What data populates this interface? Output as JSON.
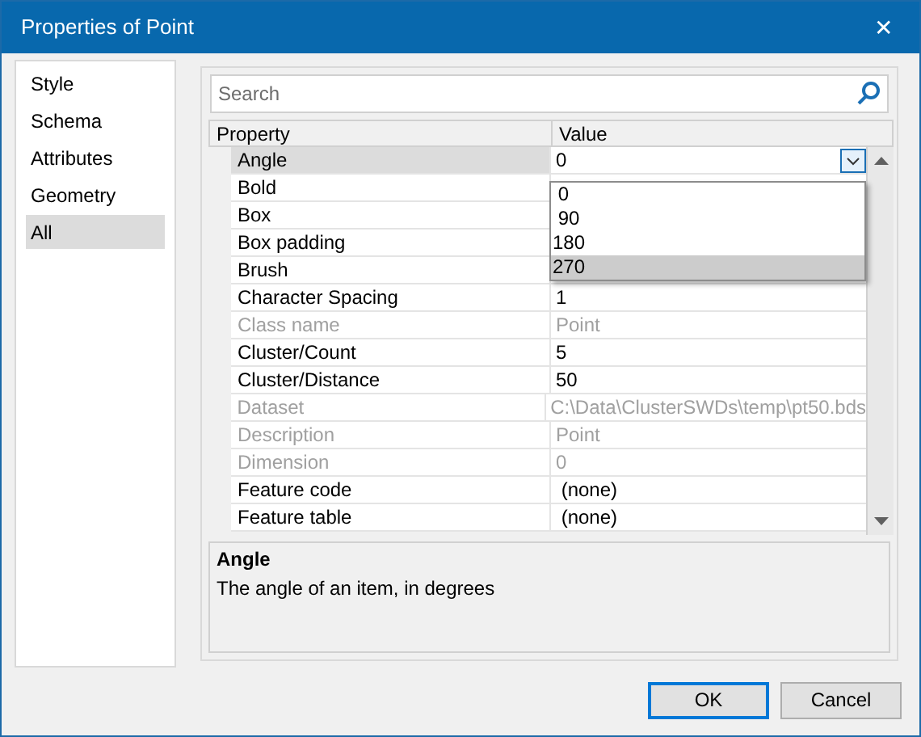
{
  "window": {
    "title": "Properties of Point",
    "close": "✕"
  },
  "sidebar": {
    "items": [
      {
        "label": "Style",
        "selected": false
      },
      {
        "label": "Schema",
        "selected": false
      },
      {
        "label": "Attributes",
        "selected": false
      },
      {
        "label": "Geometry",
        "selected": false
      },
      {
        "label": "All",
        "selected": true
      }
    ]
  },
  "search": {
    "placeholder": "Search"
  },
  "grid": {
    "columns": [
      "Property",
      "Value"
    ],
    "rows": [
      {
        "name": "Angle",
        "value": "0",
        "selected": true,
        "disabled": false
      },
      {
        "name": "Bold",
        "selected": false,
        "disabled": false
      },
      {
        "name": "Box",
        "selected": false,
        "disabled": false
      },
      {
        "name": "Box padding",
        "selected": false,
        "disabled": false
      },
      {
        "name": "Brush",
        "selected": false,
        "disabled": false
      },
      {
        "name": "Character Spacing",
        "value": "1",
        "selected": false,
        "disabled": false
      },
      {
        "name": "Class name",
        "value": "Point",
        "selected": false,
        "disabled": true
      },
      {
        "name": "Cluster/Count",
        "value": "5",
        "selected": false,
        "disabled": false
      },
      {
        "name": "Cluster/Distance",
        "value": "50",
        "selected": false,
        "disabled": false
      },
      {
        "name": "Dataset",
        "value": "C:\\Data\\ClusterSWDs\\temp\\pt50.bds",
        "selected": false,
        "disabled": true
      },
      {
        "name": "Description",
        "value": "Point",
        "selected": false,
        "disabled": true
      },
      {
        "name": "Dimension",
        "value": "0",
        "selected": false,
        "disabled": true
      },
      {
        "name": "Feature code",
        "value": " (none)",
        "selected": false,
        "disabled": false
      },
      {
        "name": "Feature table",
        "value": " (none)",
        "selected": false,
        "disabled": false
      }
    ],
    "dropdown": {
      "options": [
        {
          "label": " 0",
          "selected": false
        },
        {
          "label": " 90",
          "selected": false
        },
        {
          "label": "180",
          "selected": false
        },
        {
          "label": "270",
          "selected": true
        }
      ]
    }
  },
  "description": {
    "title": "Angle",
    "text": "The angle of an item, in degrees"
  },
  "buttons": [
    "OK",
    "Cancel"
  ]
}
